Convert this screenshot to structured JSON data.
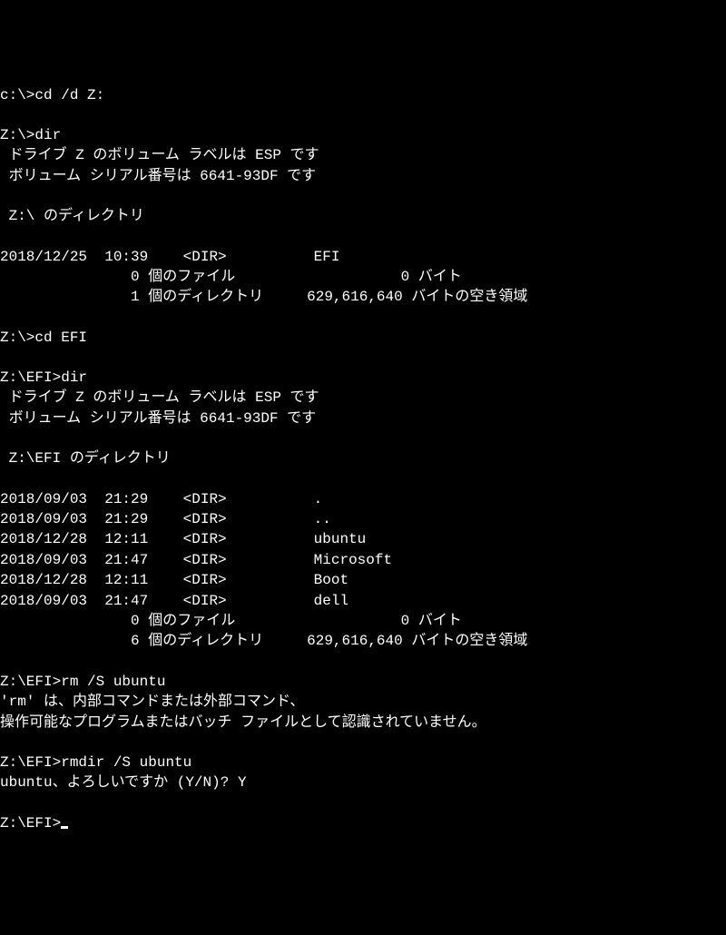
{
  "lines": [
    {
      "prompt": "c:\\>",
      "cmd": "cd /d Z:"
    },
    {
      "blank": true
    },
    {
      "prompt": "Z:\\>",
      "cmd": "dir"
    },
    {
      "text": " ドライブ Z のボリューム ラベルは ESP です"
    },
    {
      "text": " ボリューム シリアル番号は 6641-93DF です"
    },
    {
      "blank": true
    },
    {
      "text": " Z:\\ のディレクトリ"
    },
    {
      "blank": true
    },
    {
      "text": "2018/12/25  10:39    <DIR>          EFI"
    },
    {
      "text": "               0 個のファイル                   0 バイト"
    },
    {
      "text": "               1 個のディレクトリ     629,616,640 バイトの空き領域"
    },
    {
      "blank": true
    },
    {
      "prompt": "Z:\\>",
      "cmd": "cd EFI"
    },
    {
      "blank": true
    },
    {
      "prompt": "Z:\\EFI>",
      "cmd": "dir"
    },
    {
      "text": " ドライブ Z のボリューム ラベルは ESP です"
    },
    {
      "text": " ボリューム シリアル番号は 6641-93DF です"
    },
    {
      "blank": true
    },
    {
      "text": " Z:\\EFI のディレクトリ"
    },
    {
      "blank": true
    },
    {
      "text": "2018/09/03  21:29    <DIR>          ."
    },
    {
      "text": "2018/09/03  21:29    <DIR>          .."
    },
    {
      "text": "2018/12/28  12:11    <DIR>          ubuntu"
    },
    {
      "text": "2018/09/03  21:47    <DIR>          Microsoft"
    },
    {
      "text": "2018/12/28  12:11    <DIR>          Boot"
    },
    {
      "text": "2018/09/03  21:47    <DIR>          dell"
    },
    {
      "text": "               0 個のファイル                   0 バイト"
    },
    {
      "text": "               6 個のディレクトリ     629,616,640 バイトの空き領域"
    },
    {
      "blank": true
    },
    {
      "prompt": "Z:\\EFI>",
      "cmd": "rm /S ubuntu"
    },
    {
      "text": "'rm' は、内部コマンドまたは外部コマンド、"
    },
    {
      "text": "操作可能なプログラムまたはバッチ ファイルとして認識されていません。"
    },
    {
      "blank": true
    },
    {
      "prompt": "Z:\\EFI>",
      "cmd": "rmdir /S ubuntu"
    },
    {
      "text": "ubuntu、よろしいですか (Y/N)? Y"
    },
    {
      "blank": true
    },
    {
      "prompt": "Z:\\EFI>",
      "cursor": true
    }
  ]
}
